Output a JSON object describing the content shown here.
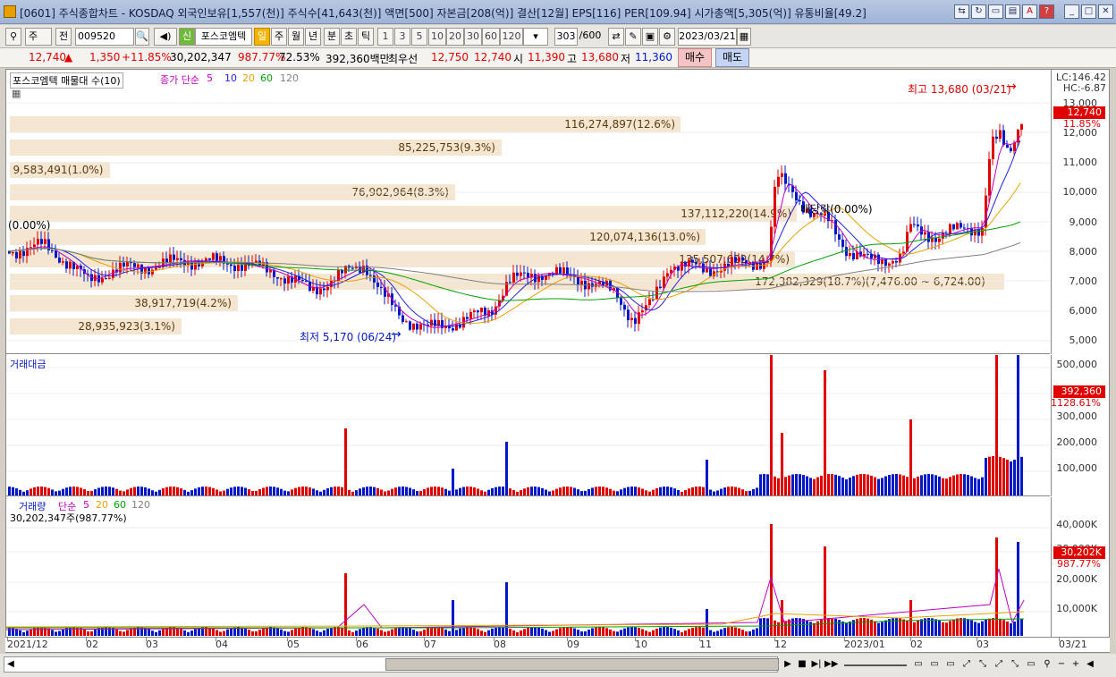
{
  "title": "[0601] 주식종합차트 - KOSDAQ 외국인보유[1,557(천)] 주식수[41,643(천)] 액면[500] 자본금[208(억)] 결산[12월] EPS[116] PER[109.94] 시가총액[5,305(억)] 유통비율[49.2]",
  "toolbar": {
    "period_select": "주",
    "prev_label": "전",
    "stock_code": "009520",
    "stock_name": "포스코엠텍",
    "badge_new": "신",
    "timeframes": [
      "일",
      "주",
      "월",
      "년",
      "분",
      "초",
      "틱"
    ],
    "active_timeframe": "일",
    "intervals": [
      "1",
      "3",
      "5",
      "10",
      "20",
      "30",
      "60",
      "120"
    ],
    "count": "303",
    "count_max": "/600",
    "date": "2023/03/21"
  },
  "pricebar": {
    "price": "12,740",
    "arrow": "▲",
    "change": "1,350",
    "change_pct": "+11.85%",
    "volume": "30,202,347",
    "volume_ratio": "987.77%",
    "ratio2": "72.53%",
    "amount": "392,360백만",
    "best_label": "최우선",
    "best_ask": "12,750",
    "best_bid": "12,740",
    "open_label": "시",
    "open": "11,390",
    "high_label": "고",
    "high": "13,680",
    "low_label": "저",
    "low": "11,360",
    "buy_label": "매수",
    "sell_label": "매도"
  },
  "price_pane": {
    "legend_title": "포스코엠텍 매물대 수(10)",
    "ma_label": "종가 단순",
    "ma_periods": [
      "5",
      "10",
      "20",
      "60",
      "120"
    ],
    "ma_colors": [
      "#c000c0",
      "#2020e0",
      "#e8a000",
      "#00a000",
      "#808080"
    ],
    "lc": "LC:146.42",
    "hc": "HC:-6.87",
    "yticks": [
      "13,000",
      "12,000",
      "11,000",
      "10,000",
      "9,000",
      "8,000",
      "7,000",
      "6,000",
      "5,000"
    ],
    "current_tag": "12,740",
    "current_pct": "11.85%",
    "high_note": "최고 13,680 (03/21)",
    "low_note": "최저 5,170 (06/24)",
    "dividend_note": "배당락(0.00%)",
    "left_note": "(0.00%)",
    "volume_profile": [
      "116,274,897(12.6%)",
      "85,225,753(9.3%)",
      "9,583,491(1.0%)",
      "76,902,964(8.3%)",
      "137,112,220(14.9%)",
      "120,074,136(13.0%)",
      "135,507,622(14.7%)",
      "172,382,329(18.7%)(7,476.00 ~ 6,724.00)",
      "38,917,719(4.2%)",
      "28,935,923(3.1%)"
    ]
  },
  "amount_pane": {
    "title": "거래대금",
    "yticks": [
      "500,000",
      "400,000",
      "300,000",
      "200,000",
      "100,000"
    ],
    "current_tag": "392,360",
    "current_pct": "1128.61%"
  },
  "volume_pane": {
    "title": "거래량",
    "ma_label": "단순",
    "ma_periods": [
      "5",
      "20",
      "60",
      "120"
    ],
    "value_line": "30,202,347주(987.77%)",
    "yticks": [
      "40,000K",
      "30,000K",
      "20,000K",
      "10,000K"
    ],
    "current_tag": "30,202K",
    "current_pct": "987.77%"
  },
  "xaxis": [
    "2021/12",
    "02",
    "03",
    "04",
    "05",
    "06",
    "07",
    "08",
    "09",
    "10",
    "11",
    "12",
    "2023/01",
    "02",
    "03",
    "03/21"
  ],
  "colors": {
    "up": "#e00000",
    "down": "#0018c8",
    "profile": "#f5e6d2",
    "ma5": "#c000c0",
    "ma10": "#2020e0",
    "ma20": "#e8a000",
    "ma60": "#00a000",
    "ma120": "#808080"
  }
}
